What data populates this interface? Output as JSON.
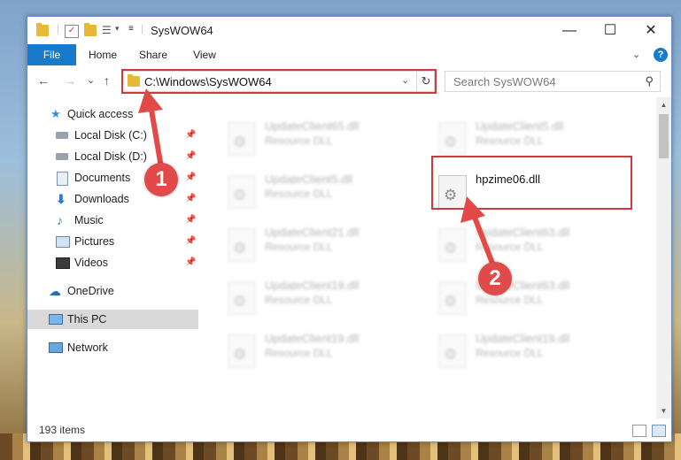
{
  "window": {
    "title": "SysWOW64",
    "controls": {
      "minimize": "—",
      "maximize": "☐",
      "close": "✕"
    }
  },
  "ribbon": {
    "tabs": [
      "File",
      "Home",
      "Share",
      "View"
    ],
    "help": "?"
  },
  "navigation": {
    "back": "←",
    "forward": "→",
    "recent": "⌄",
    "up": "↑",
    "address": "C:\\Windows\\SysWOW64",
    "refresh": "↻",
    "search_placeholder": "Search SysWOW64"
  },
  "sidebar": {
    "items": [
      {
        "label": "Quick access",
        "icon": "star-icon"
      },
      {
        "label": "Local Disk (C:)",
        "icon": "drive-icon",
        "pinned": true
      },
      {
        "label": "Local Disk (D:)",
        "icon": "drive-icon",
        "pinned": true
      },
      {
        "label": "Documents",
        "icon": "documents-icon",
        "pinned": true
      },
      {
        "label": "Downloads",
        "icon": "download-icon",
        "pinned": true
      },
      {
        "label": "Music",
        "icon": "music-icon",
        "pinned": true
      },
      {
        "label": "Pictures",
        "icon": "pictures-icon",
        "pinned": true
      },
      {
        "label": "Videos",
        "icon": "videos-icon",
        "pinned": true
      },
      {
        "label": "OneDrive",
        "icon": "cloud-icon"
      },
      {
        "label": "This PC",
        "icon": "computer-icon",
        "selected": true
      },
      {
        "label": "Network",
        "icon": "network-icon"
      }
    ],
    "pin_glyph": "📌"
  },
  "files": [
    {
      "name": "UpdateClient65.dll",
      "type": "Resource DLL"
    },
    {
      "name": "UpdateClient5.dll",
      "type": "Resource DLL"
    },
    {
      "name": "UpdateClient5.dll",
      "type": "Resource DLL"
    },
    {
      "name": "hpzime06.dll",
      "type": "",
      "highlighted": true
    },
    {
      "name": "UpdateClient21.dll",
      "type": "Resource DLL"
    },
    {
      "name": "UpdateClient63.dll",
      "type": "Resource DLL"
    },
    {
      "name": "UpdateClient19.dll",
      "type": "Resource DLL"
    },
    {
      "name": "UpdateClient63.dll",
      "type": "Resource DLL"
    },
    {
      "name": "UpdateClient19.dll",
      "type": "Resource DLL"
    },
    {
      "name": "UpdateClient19.dll",
      "type": "Resource DLL"
    }
  ],
  "status": {
    "item_count": "193 items"
  },
  "annotations": {
    "step1": "1",
    "step2": "2",
    "color": "#d0373e"
  },
  "colors": {
    "accent": "#1979ca"
  }
}
